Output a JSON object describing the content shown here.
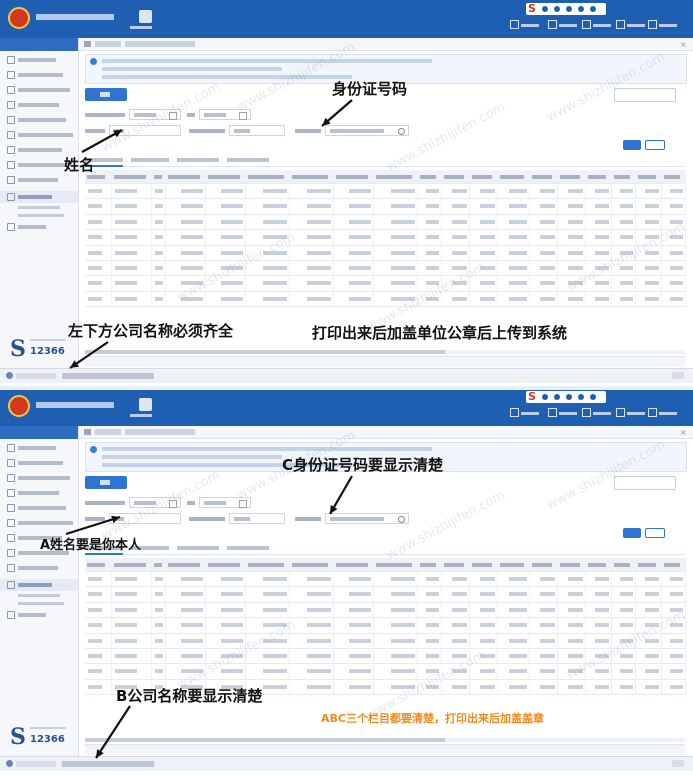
{
  "watermark": "www.shizhijifen.com",
  "panels": {
    "top": {
      "annotations": {
        "id_number": "身份证号码",
        "name": "姓名",
        "company_note": "左下方公司名称必须齐全",
        "print_note": "打印出来后加盖单位公章后上传到系统"
      }
    },
    "bottom": {
      "annotations": {
        "id_number": "C身份证号码要显示清楚",
        "name": "A姓名要是你本人",
        "company_note": "B公司名称要显示清楚",
        "print_note": "ABC三个栏目都要清楚，打印出来后加盖盖章"
      }
    }
  },
  "colors": {
    "title_bar": "#1f5fb2",
    "primary_button": "#2f74d0",
    "annotation_black": "#111111",
    "annotation_orange": "#f08a1c",
    "logo_red": "#d2381c"
  }
}
